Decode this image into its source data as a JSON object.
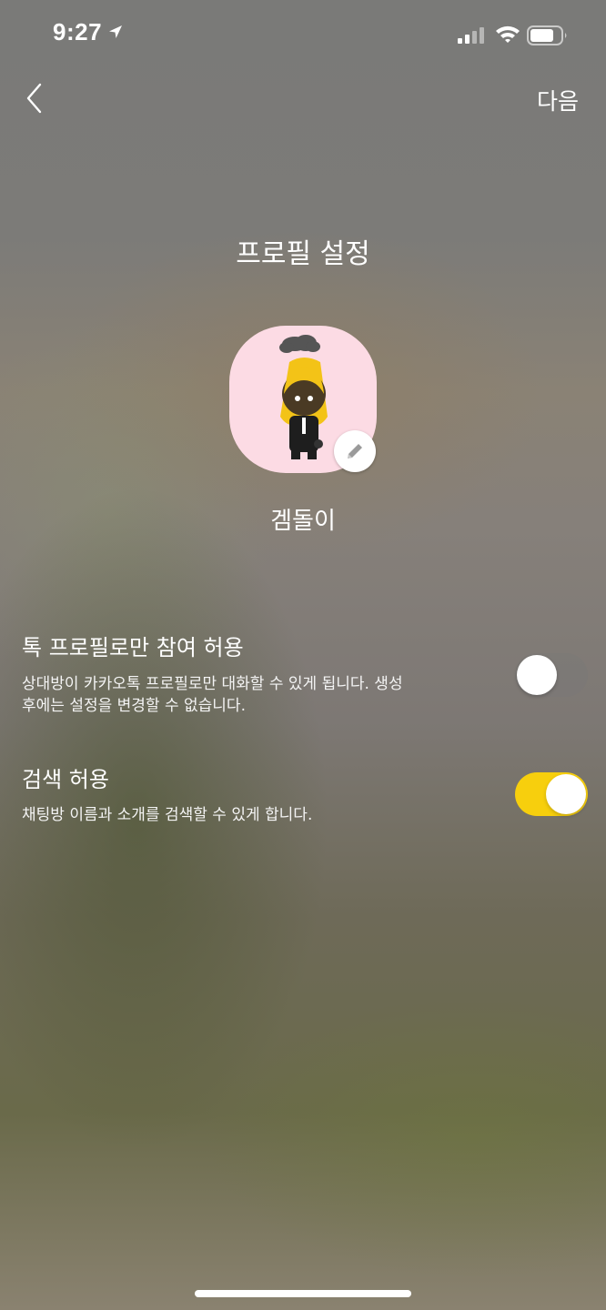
{
  "status_bar": {
    "time": "9:27",
    "icons": [
      "location-arrow-icon",
      "cellular-signal-icon",
      "wifi-icon",
      "battery-icon"
    ]
  },
  "nav": {
    "back_icon": "chevron-left-icon",
    "next_label": "다음"
  },
  "page": {
    "title": "프로필 설정",
    "nickname": "겜돌이",
    "edit_icon": "pencil-icon"
  },
  "settings": [
    {
      "title": "톡 프로필로만 참여 허용",
      "description_line1": "상대방이 카카오톡 프로필로만 대화할 수 있게 됩니다. 생성",
      "description_line2": "후에는 설정을 변경할 수 없습니다.",
      "enabled": false
    },
    {
      "title": "검색 허용",
      "description_line1": "채팅방 이름과 소개를 검색할 수 있게 합니다.",
      "enabled": true
    }
  ],
  "colors": {
    "toggle_on": "#f7cf0d",
    "avatar_background": "#fcdbe4"
  }
}
